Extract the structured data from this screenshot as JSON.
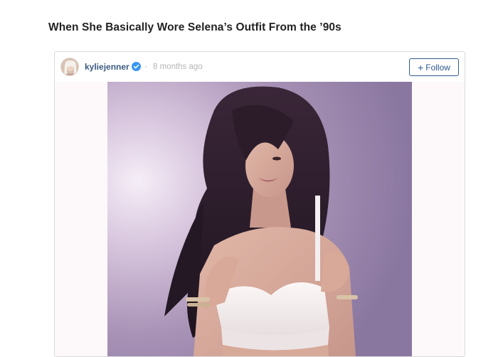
{
  "article": {
    "headline": "When She Basically Wore Selena’s Outfit From the ’90s"
  },
  "embed": {
    "username": "kyliejenner",
    "verified": true,
    "separator": "·",
    "timestamp": "8 months ago",
    "follow_plus": "+",
    "follow_label": "Follow",
    "icons": {
      "avatar": "profile-avatar",
      "verified": "verified-badge-icon"
    },
    "colors": {
      "username": "#3a5a80",
      "follow_border": "#2f5b8f",
      "verified_blue": "#3897f0"
    }
  }
}
